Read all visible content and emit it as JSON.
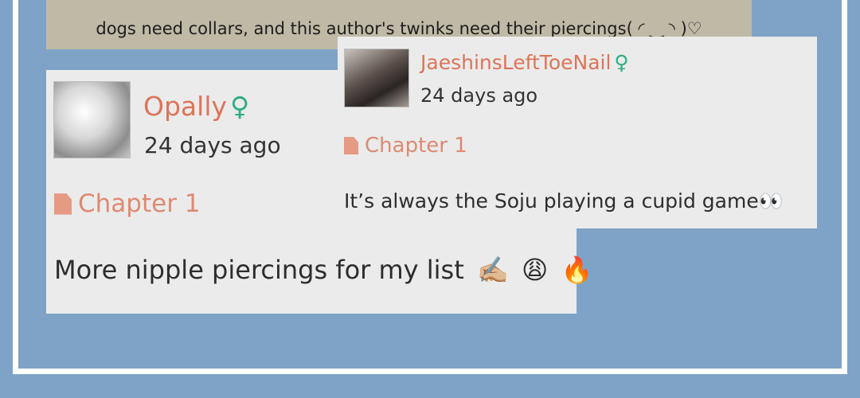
{
  "banner": {
    "text": "dogs need collars, and this author's twinks need their piercings( ◜ ‿ ◝ )♡"
  },
  "comments": [
    {
      "username": "Opally",
      "gender_symbol": "♀",
      "time": "24 days ago",
      "chapter": "Chapter 1",
      "text": "More nipple piercings for my list",
      "emojis": [
        "✍🏼",
        "😩",
        "🔥"
      ]
    },
    {
      "username": "JaeshinsLeftToeNail",
      "gender_symbol": "♀",
      "time": "24 days ago",
      "chapter": "Chapter 1",
      "text": "It’s always the Soju playing a cupid game",
      "emojis": [
        "👀"
      ]
    }
  ],
  "colors": {
    "background": "#7fa3c7",
    "card": "#ebebeb",
    "banner": "#bfb9a6",
    "username": "#dd7459",
    "gender": "#2fad82",
    "chapter": "#dd8a72"
  },
  "icons": {
    "chapter": "file-icon",
    "gender": "female-sign-icon"
  }
}
